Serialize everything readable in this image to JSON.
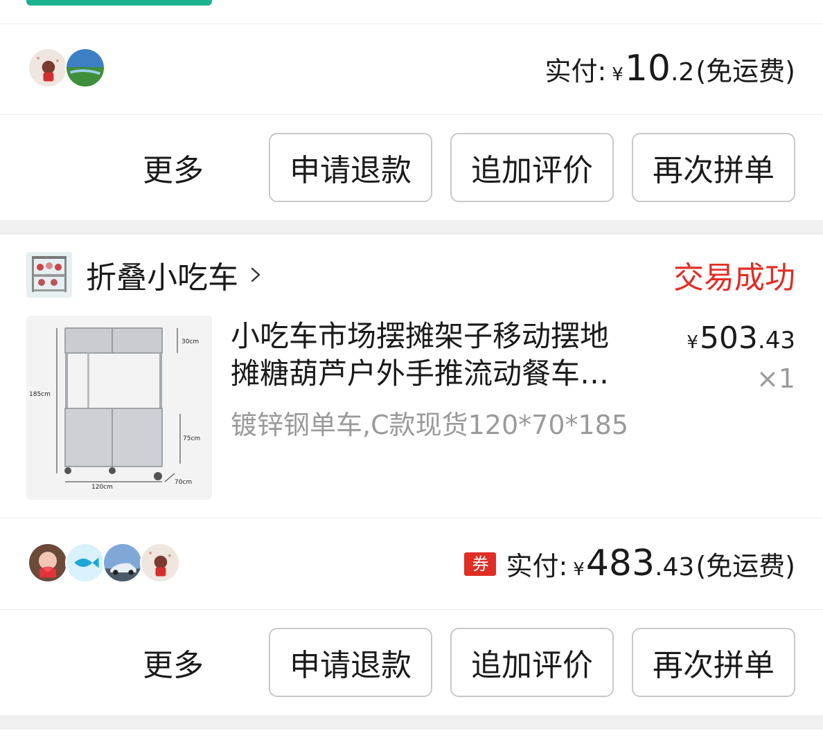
{
  "order1": {
    "paid_label": "实付:",
    "currency": "¥",
    "amount_int": "10",
    "amount_dec": ".2",
    "shipping_note": "(免运费)",
    "actions": {
      "more": "更多",
      "refund": "申请退款",
      "review": "追加评价",
      "reorder": "再次拼单"
    }
  },
  "order2": {
    "shop_name": "折叠小吃车",
    "status": "交易成功",
    "product": {
      "title_line1": "小吃车市场摆摊架子移动摆地",
      "title_line2": "摊糖葫芦户外手推流动餐车…",
      "spec": "镀锌钢单车,C款现货120*70*185",
      "currency": "¥",
      "price_int": "503",
      "price_dec": ".43",
      "qty": "×1",
      "dims": {
        "top": "30cm",
        "height": "185cm",
        "cabinet": "75cm",
        "width": "120cm",
        "depth": "70cm"
      }
    },
    "coupon_label": "券",
    "paid_label": "实付:",
    "currency": "¥",
    "amount_int": "483",
    "amount_dec": ".43",
    "shipping_note": "(免运费)",
    "actions": {
      "more": "更多",
      "refund": "申请退款",
      "review": "追加评价",
      "reorder": "再次拼单"
    }
  },
  "colors": {
    "status_red": "#e02e24",
    "accent_green": "#1bb38f",
    "muted_text": "#9a9a9a"
  }
}
